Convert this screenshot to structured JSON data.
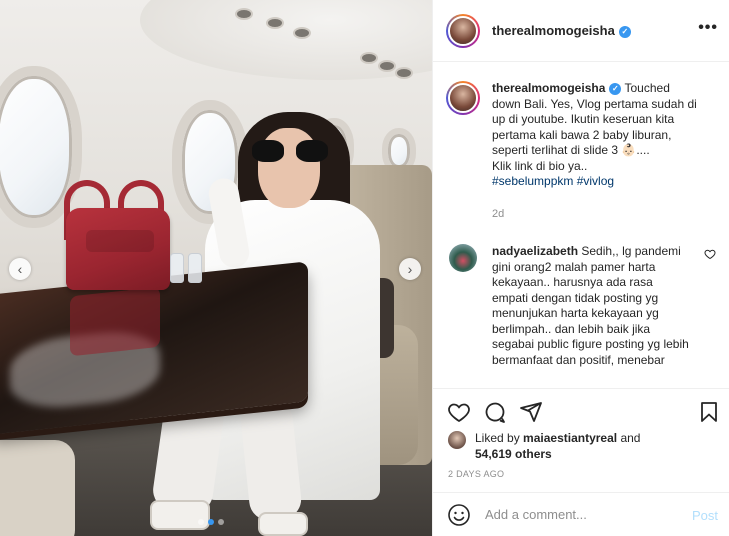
{
  "post": {
    "username": "therealmomogeisha",
    "verified": true,
    "more_icon": "•••"
  },
  "caption": {
    "username": "therealmomogeisha",
    "line1": "Touched down Bali. Yes, Vlog pertama sudah di up di youtube. Ikutin keseruan kita pertama kali bawa 2 baby liburan, seperti terlihat di slide 3 👶🏻....",
    "line2": "Klik link di bio ya..",
    "hashtags": "#sebelumppkm #vivlog",
    "time": "2d"
  },
  "comment": {
    "username": "nadyaelizabeth",
    "text": "Sedih,, lg pandemi gini orang2 malah pamer harta kekayaan.. harusnya ada rasa empati dengan tidak posting yg menunjukan harta kekayaan yg berlimpah.. dan lebih baik jika segabai public figure posting yg lebih bermanfaat dan positif, menebar"
  },
  "likes": {
    "prefix": "Liked by",
    "user": "maiaestiantyreal",
    "conj": "and",
    "count": "54,619 others"
  },
  "date": "2 DAYS AGO",
  "add_comment": {
    "placeholder": "Add a comment...",
    "post_label": "Post"
  },
  "carousel": {
    "prev": "‹",
    "next": "›",
    "dots": 3,
    "active": 1
  },
  "colors": {
    "link": "#00376b",
    "verified": "#3897f0",
    "muted": "#8e8e8e",
    "post_disabled": "#b2dffc"
  }
}
